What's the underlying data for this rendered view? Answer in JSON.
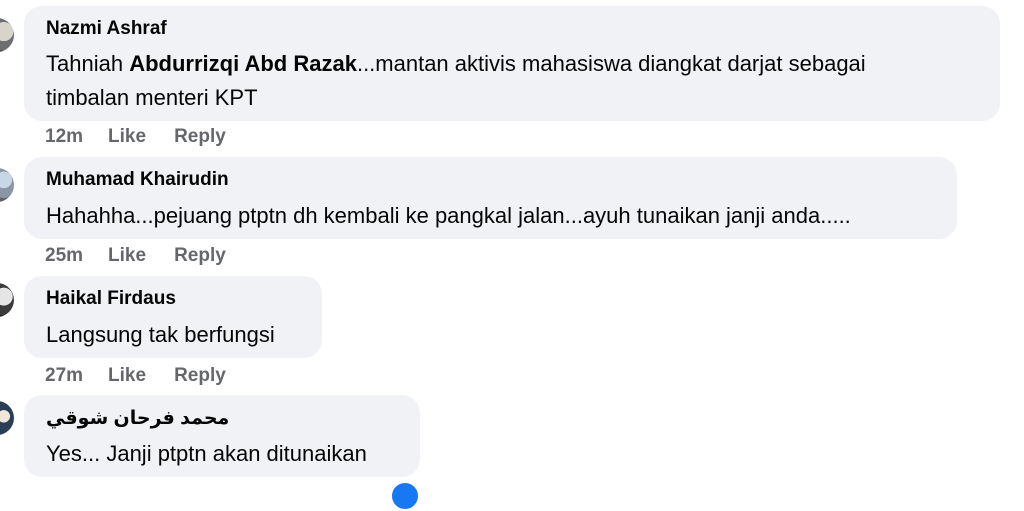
{
  "comments": [
    {
      "author": "Nazmi Ashraf",
      "text_before": "Tahniah ",
      "mention": "Abdurrizqi Abd Razak",
      "text_line1_after": "...mantan aktivis mahasiswa diangkat darjat sebagai",
      "text_line2": "timbalan menteri KPT",
      "time": "12m",
      "like": "Like",
      "reply": "Reply"
    },
    {
      "author": "Muhamad Khairudin",
      "text": "Hahahha...pejuang ptptn dh kembali ke pangkal jalan...ayuh tunaikan janji anda.....",
      "time": "25m",
      "like": "Like",
      "reply": "Reply"
    },
    {
      "author": "Haikal Firdaus",
      "text": "Langsung tak berfungsi",
      "time": "27m",
      "like": "Like",
      "reply": "Reply"
    },
    {
      "author": "محمد فرحان شوقي",
      "text": "Yes... Janji ptptn akan ditunaikan",
      "time": "",
      "like": "",
      "reply": ""
    }
  ],
  "colors": {
    "bubble_bg": "#f0f2f5",
    "meta_text": "#65676b",
    "reaction_blue": "#1877f2"
  },
  "icons": {
    "avatar": "avatar-photo",
    "reaction": "like-reaction-icon"
  }
}
